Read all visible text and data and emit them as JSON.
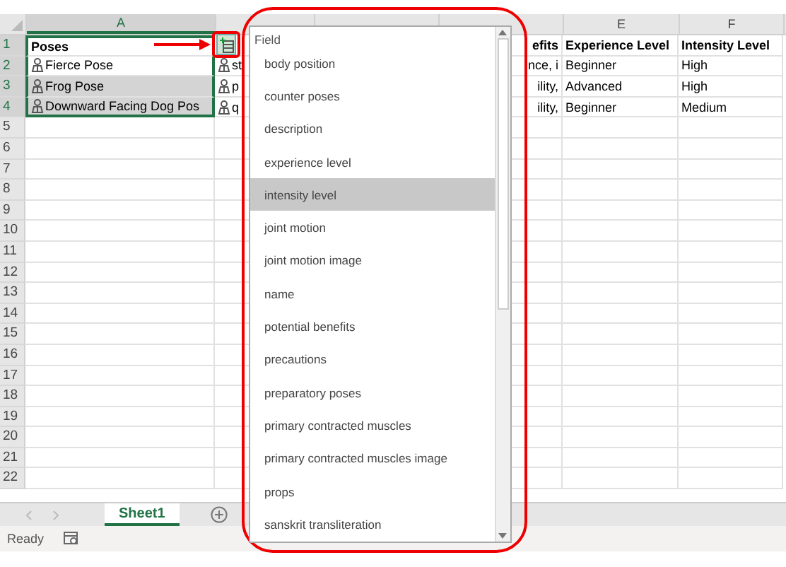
{
  "columns": [
    {
      "label": "A",
      "selected": true
    },
    {
      "selected": false
    },
    {
      "selected": false
    },
    {
      "selected": false
    },
    {
      "label": "E",
      "selected": false
    },
    {
      "label": "F",
      "selected": false
    }
  ],
  "rows": [
    {
      "number": "1",
      "header": true,
      "cells": [
        {
          "text": "Poses",
          "selected": true,
          "highlighted": false,
          "linked": false
        },
        {},
        {},
        {
          "text": "efits"
        },
        {
          "text": "Experience Level"
        },
        {
          "text": "Intensity Level"
        }
      ]
    },
    {
      "number": "2",
      "header": false,
      "cells": [
        {
          "text": "Fierce Pose",
          "selected": true,
          "highlighted": false,
          "linked": true
        },
        {
          "text": "st",
          "linked": true
        },
        {},
        {
          "text": "nce, i"
        },
        {
          "text": "Beginner"
        },
        {
          "text": "High"
        }
      ]
    },
    {
      "number": "3",
      "header": false,
      "cells": [
        {
          "text": "Frog Pose",
          "selected": true,
          "highlighted": true,
          "linked": true
        },
        {
          "text": "p",
          "linked": true
        },
        {},
        {
          "text": "ility,"
        },
        {
          "text": "Advanced"
        },
        {
          "text": "High"
        }
      ]
    },
    {
      "number": "4",
      "header": false,
      "cells": [
        {
          "text": "Downward Facing Dog Pos",
          "selected": true,
          "highlighted": true,
          "linked": true
        },
        {
          "text": "q",
          "linked": true
        },
        {},
        {
          "text": "ility,"
        },
        {
          "text": "Beginner"
        },
        {
          "text": "Medium"
        }
      ]
    },
    {
      "number": "5"
    },
    {
      "number": "6"
    },
    {
      "number": "7"
    },
    {
      "number": "8"
    },
    {
      "number": "9"
    },
    {
      "number": "10"
    },
    {
      "number": "11"
    },
    {
      "number": "12"
    },
    {
      "number": "13"
    },
    {
      "number": "14"
    },
    {
      "number": "15"
    },
    {
      "number": "16"
    },
    {
      "number": "17"
    },
    {
      "number": "18"
    },
    {
      "number": "19"
    },
    {
      "number": "20"
    },
    {
      "number": "21"
    },
    {
      "number": "22"
    }
  ],
  "field_list": {
    "header": "Field",
    "items": [
      {
        "label": "body position",
        "selected": false
      },
      {
        "label": "counter poses",
        "selected": false
      },
      {
        "label": "description",
        "selected": false
      },
      {
        "label": "experience level",
        "selected": false
      },
      {
        "label": "intensity level",
        "selected": true
      },
      {
        "label": "joint motion",
        "selected": false
      },
      {
        "label": "joint motion image",
        "selected": false
      },
      {
        "label": "name",
        "selected": false
      },
      {
        "label": "potential benefits",
        "selected": false
      },
      {
        "label": "precautions",
        "selected": false
      },
      {
        "label": "preparatory poses",
        "selected": false
      },
      {
        "label": "primary contracted muscles",
        "selected": false
      },
      {
        "label": "primary contracted muscles image",
        "selected": false
      },
      {
        "label": "props",
        "selected": false
      },
      {
        "label": "sanskrit transliteration",
        "selected": false
      }
    ]
  },
  "sheet_tabs": [
    {
      "label": "Sheet1",
      "selected": true
    }
  ],
  "status_bar": {
    "text": "Ready"
  }
}
